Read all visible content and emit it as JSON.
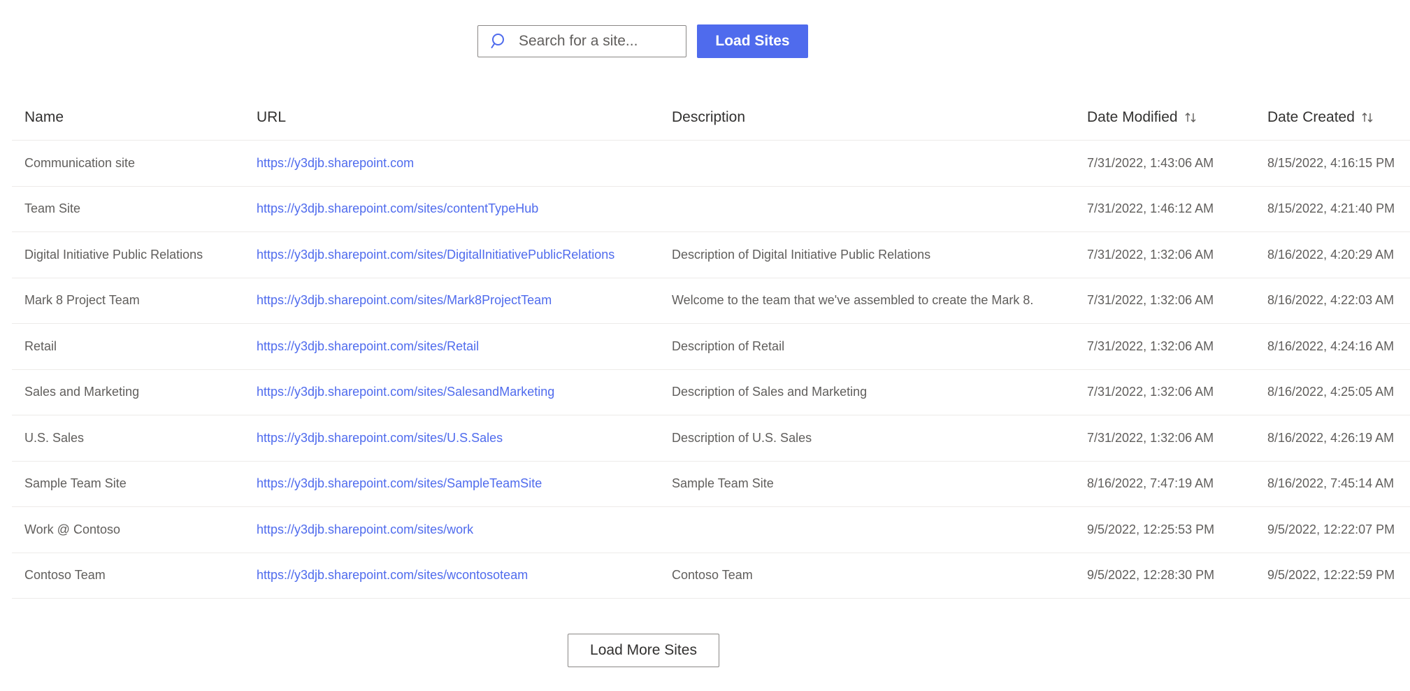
{
  "toolbar": {
    "search_placeholder": "Search for a site...",
    "load_sites_label": "Load Sites"
  },
  "table": {
    "columns": [
      "Name",
      "URL",
      "Description",
      "Date Modified",
      "Date Created"
    ],
    "rows": [
      {
        "name": "Communication site",
        "url": "https://y3djb.sharepoint.com",
        "description": "",
        "modified": "7/31/2022, 1:43:06 AM",
        "created": "8/15/2022, 4:16:15 PM"
      },
      {
        "name": "Team Site",
        "url": "https://y3djb.sharepoint.com/sites/contentTypeHub",
        "description": "",
        "modified": "7/31/2022, 1:46:12 AM",
        "created": "8/15/2022, 4:21:40 PM"
      },
      {
        "name": "Digital Initiative Public Relations",
        "url": "https://y3djb.sharepoint.com/sites/DigitalInitiativePublicRelations",
        "description": "Description of Digital Initiative Public Relations",
        "modified": "7/31/2022, 1:32:06 AM",
        "created": "8/16/2022, 4:20:29 AM"
      },
      {
        "name": "Mark 8 Project Team",
        "url": "https://y3djb.sharepoint.com/sites/Mark8ProjectTeam",
        "description": "Welcome to the team that we've assembled to create the Mark 8.",
        "modified": "7/31/2022, 1:32:06 AM",
        "created": "8/16/2022, 4:22:03 AM"
      },
      {
        "name": "Retail",
        "url": "https://y3djb.sharepoint.com/sites/Retail",
        "description": "Description of Retail",
        "modified": "7/31/2022, 1:32:06 AM",
        "created": "8/16/2022, 4:24:16 AM"
      },
      {
        "name": "Sales and Marketing",
        "url": "https://y3djb.sharepoint.com/sites/SalesandMarketing",
        "description": "Description of Sales and Marketing",
        "modified": "7/31/2022, 1:32:06 AM",
        "created": "8/16/2022, 4:25:05 AM"
      },
      {
        "name": "U.S. Sales",
        "url": "https://y3djb.sharepoint.com/sites/U.S.Sales",
        "description": "Description of U.S. Sales",
        "modified": "7/31/2022, 1:32:06 AM",
        "created": "8/16/2022, 4:26:19 AM"
      },
      {
        "name": "Sample Team Site",
        "url": "https://y3djb.sharepoint.com/sites/SampleTeamSite",
        "description": "Sample Team Site",
        "modified": "8/16/2022, 7:47:19 AM",
        "created": "8/16/2022, 7:45:14 AM"
      },
      {
        "name": "Work @ Contoso",
        "url": "https://y3djb.sharepoint.com/sites/work",
        "description": "",
        "modified": "9/5/2022, 12:25:53 PM",
        "created": "9/5/2022, 12:22:07 PM"
      },
      {
        "name": "Contoso Team",
        "url": "https://y3djb.sharepoint.com/sites/wcontosoteam",
        "description": "Contoso Team",
        "modified": "9/5/2022, 12:28:30 PM",
        "created": "9/5/2022, 12:22:59 PM"
      }
    ]
  },
  "footer": {
    "load_more_label": "Load More Sites"
  },
  "colors": {
    "accent": "#4f6bed",
    "text": "#605e5c",
    "header_text": "#323130",
    "divider": "#edebe9"
  },
  "icons": [
    "search-icon",
    "sort-icon"
  ]
}
